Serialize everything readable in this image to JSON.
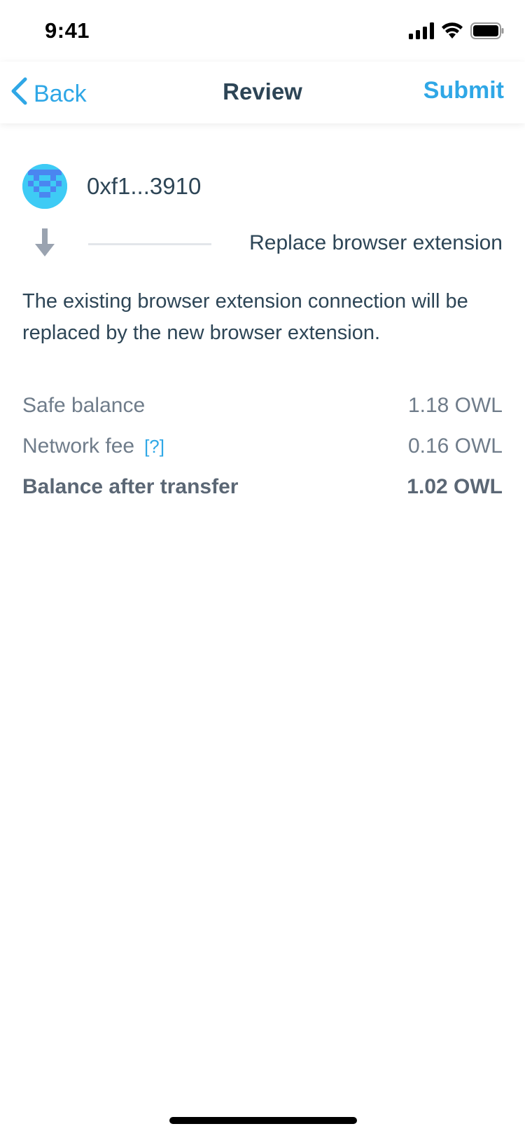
{
  "status_bar": {
    "time": "9:41"
  },
  "nav": {
    "back_label": "Back",
    "title": "Review",
    "submit_label": "Submit"
  },
  "account": {
    "address": "0xf1...3910"
  },
  "transfer": {
    "label": "Replace browser extension"
  },
  "description": "The existing browser extension connection will be replaced by the new browser extension.",
  "summary": {
    "safe_balance_label": "Safe balance",
    "safe_balance_value": "1.18 OWL",
    "network_fee_label": "Network fee",
    "network_fee_help": "[?]",
    "network_fee_value": "0.16 OWL",
    "balance_after_label": "Balance after transfer",
    "balance_after_value": "1.02 OWL"
  },
  "colors": {
    "accent": "#2fa7e6",
    "text_primary": "#2d4556",
    "text_secondary": "#6f7c8a",
    "avatar_bg": "#3ecbf5"
  },
  "icons": {
    "back": "chevron-left-icon",
    "signal": "cellular-signal-icon",
    "wifi": "wifi-icon",
    "battery": "battery-icon",
    "arrow": "arrow-down-icon"
  }
}
